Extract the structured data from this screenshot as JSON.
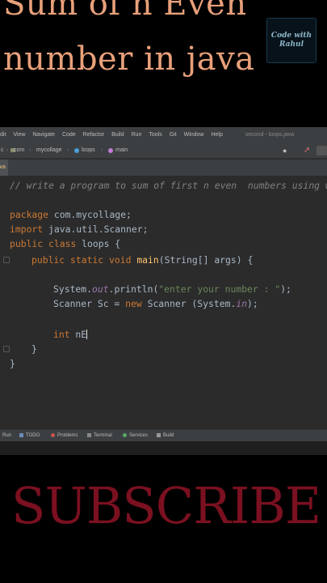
{
  "overlay": {
    "title_line1": "Sum of  n Even",
    "title_line2": "number in java",
    "badge_line1": "Code with",
    "badge_line2": "Rahul",
    "subscribe": "SUBSCRIBE"
  },
  "menu": [
    "dit",
    "View",
    "Navigate",
    "Code",
    "Refactor",
    "Build",
    "Run",
    "Tools",
    "Git",
    "Window",
    "Help"
  ],
  "window_title": "second - loops.java",
  "breadcrumb": [
    "c",
    "com",
    "mycollage",
    "loops",
    "main"
  ],
  "tab": {
    "label": "java"
  },
  "editor": {
    "comment": "// write a program to sum of first n even  numbers using wh",
    "package_kw": "package",
    "package_name": " com.mycollage;",
    "import_kw": "import",
    "import_name": " java.util.Scanner;",
    "class_kw": "public class",
    "class_name": " loops {",
    "main_kw": "public static void",
    "main_name": "main",
    "main_args": "(String[] args) {",
    "println_pre": "System.",
    "println_field": "out",
    "println_mid": ".println(",
    "println_str": "\"enter your number : \"",
    "println_end": ");",
    "scanner_pre": "Scanner Sc = ",
    "scanner_kw": "new",
    "scanner_mid": " Scanner (System.",
    "scanner_field": "in",
    "scanner_end": ");",
    "int_kw": "int",
    "int_var": " nE",
    "close_method": "}",
    "close_class": "}"
  },
  "status_tools": [
    "Run",
    "TODO",
    "Problems",
    "Terminal",
    "Services",
    "Build"
  ]
}
